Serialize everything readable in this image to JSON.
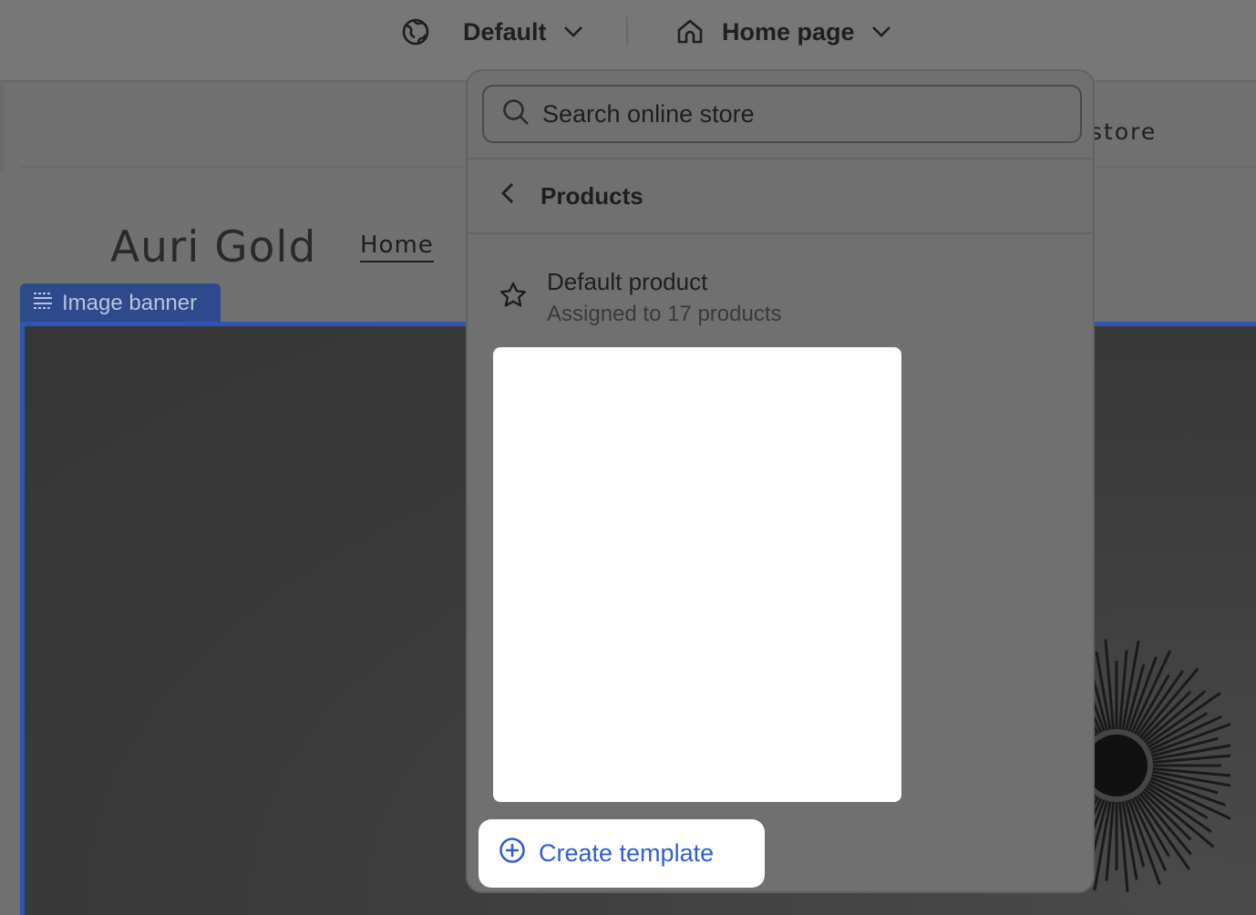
{
  "topbar": {
    "theme_label": "Default",
    "page_label": "Home page"
  },
  "editor": {
    "brand_name": "Auri Gold",
    "nav_home": "Home",
    "header_right_text": "store",
    "section_tag": "Image banner"
  },
  "dropdown": {
    "search_placeholder": "Search online store",
    "back_label": "Products",
    "template": {
      "name": "Default product",
      "assigned": "Assigned to 17 products"
    },
    "create_label": "Create template"
  },
  "colors": {
    "accent": "#2f5fcf",
    "section_tag_bg": "#2e4a8c",
    "overlay": "#707070"
  },
  "icons": {
    "theme": "globe-icon",
    "page": "home-icon",
    "chevron": "chevron-down-icon",
    "search": "search-icon",
    "back": "chevron-left-icon",
    "template": "star-icon",
    "create": "plus-circle-icon",
    "section": "banner-icon"
  }
}
